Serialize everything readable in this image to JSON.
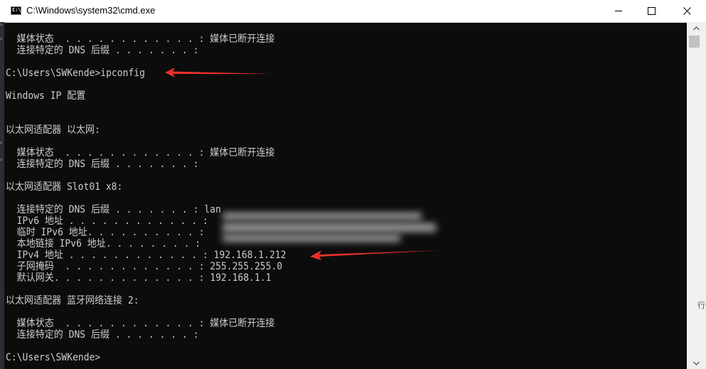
{
  "window": {
    "title": "C:\\Windows\\system32\\cmd.exe",
    "icon_glyph": "C:\\"
  },
  "console": {
    "lines": [
      "  媒体状态  . . . . . . . . . . . . : 媒体已断开连接",
      "  连接特定的 DNS 后缀 . . . . . . . :",
      "",
      "C:\\Users\\SWKende>ipconfig",
      "",
      "Windows IP 配置",
      "",
      "",
      "以太网适配器 以太网:",
      "",
      "  媒体状态  . . . . . . . . . . . . : 媒体已断开连接",
      "  连接特定的 DNS 后缀 . . . . . . . :",
      "",
      "以太网适配器 Slot01 x8:",
      "",
      "  连接特定的 DNS 后缀 . . . . . . . : lan",
      "  IPv6 地址 . . . . . . . . . . . . :",
      "  临时 IPv6 地址. . . . . . . . . . :",
      "  本地链接 IPv6 地址. . . . . . . . :",
      "  IPv4 地址 . . . . . . . . . . . . : 192.168.1.212",
      "  子网掩码  . . . . . . . . . . . . : 255.255.255.0",
      "  默认网关. . . . . . . . . . . . . : 192.168.1.1",
      "",
      "以太网适配器 蓝牙网络连接 2:",
      "",
      "  媒体状态  . . . . . . . . . . . . : 媒体已断开连接",
      "  连接特定的 DNS 后缀 . . . . . . . :",
      "",
      "C:\\Users\\SWKende>"
    ]
  },
  "colors": {
    "console_bg": "#0c0c0c",
    "console_text": "#cccccc",
    "annotation_arrow": "#e8302a"
  },
  "icons": {
    "minimize": "minimize-icon",
    "maximize": "maximize-icon",
    "close": "close-icon",
    "scroll_up": "chevron-up-icon",
    "scroll_down": "chevron-down-icon"
  },
  "background_fragment": "行"
}
